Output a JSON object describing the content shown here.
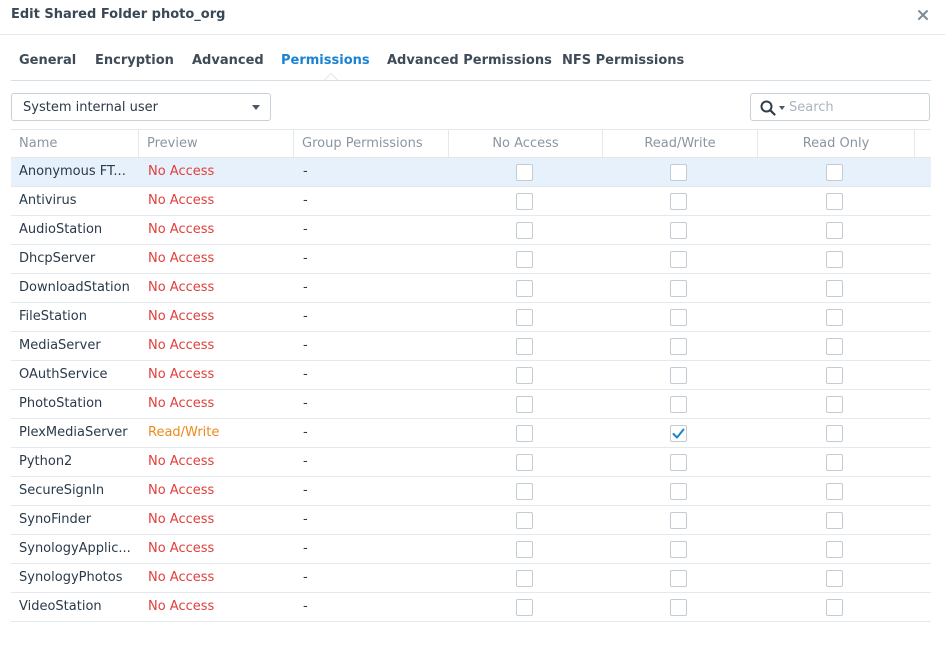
{
  "window": {
    "title": "Edit Shared Folder photo_org"
  },
  "tabs": [
    {
      "label": "General",
      "active": false
    },
    {
      "label": "Encryption",
      "active": false
    },
    {
      "label": "Advanced",
      "active": false
    },
    {
      "label": "Permissions",
      "active": true
    },
    {
      "label": "Advanced Permissions",
      "active": false
    },
    {
      "label": "NFS Permissions",
      "active": false
    }
  ],
  "user_type_select": {
    "value": "System internal user"
  },
  "search": {
    "placeholder": "Search",
    "value": ""
  },
  "columns": {
    "name": "Name",
    "preview": "Preview",
    "group_permissions": "Group Permissions",
    "no_access": "No Access",
    "read_write": "Read/Write",
    "read_only": "Read Only"
  },
  "colors": {
    "accent": "#1a83d1",
    "no_access": "#e0403b",
    "read_write": "#ee8a1c",
    "selected_row": "#e6f1fb"
  },
  "rows": [
    {
      "name": "Anonymous FT...",
      "preview": "No Access",
      "group": "-",
      "no_access": false,
      "read_write": false,
      "read_only": false,
      "selected": true
    },
    {
      "name": "Antivirus",
      "preview": "No Access",
      "group": "-",
      "no_access": false,
      "read_write": false,
      "read_only": false
    },
    {
      "name": "AudioStation",
      "preview": "No Access",
      "group": "-",
      "no_access": false,
      "read_write": false,
      "read_only": false
    },
    {
      "name": "DhcpServer",
      "preview": "No Access",
      "group": "-",
      "no_access": false,
      "read_write": false,
      "read_only": false
    },
    {
      "name": "DownloadStation",
      "preview": "No Access",
      "group": "-",
      "no_access": false,
      "read_write": false,
      "read_only": false
    },
    {
      "name": "FileStation",
      "preview": "No Access",
      "group": "-",
      "no_access": false,
      "read_write": false,
      "read_only": false
    },
    {
      "name": "MediaServer",
      "preview": "No Access",
      "group": "-",
      "no_access": false,
      "read_write": false,
      "read_only": false
    },
    {
      "name": "OAuthService",
      "preview": "No Access",
      "group": "-",
      "no_access": false,
      "read_write": false,
      "read_only": false
    },
    {
      "name": "PhotoStation",
      "preview": "No Access",
      "group": "-",
      "no_access": false,
      "read_write": false,
      "read_only": false
    },
    {
      "name": "PlexMediaServer",
      "preview": "Read/Write",
      "group": "-",
      "no_access": false,
      "read_write": true,
      "read_only": false
    },
    {
      "name": "Python2",
      "preview": "No Access",
      "group": "-",
      "no_access": false,
      "read_write": false,
      "read_only": false
    },
    {
      "name": "SecureSignIn",
      "preview": "No Access",
      "group": "-",
      "no_access": false,
      "read_write": false,
      "read_only": false
    },
    {
      "name": "SynoFinder",
      "preview": "No Access",
      "group": "-",
      "no_access": false,
      "read_write": false,
      "read_only": false
    },
    {
      "name": "SynologyApplic...",
      "preview": "No Access",
      "group": "-",
      "no_access": false,
      "read_write": false,
      "read_only": false
    },
    {
      "name": "SynologyPhotos",
      "preview": "No Access",
      "group": "-",
      "no_access": false,
      "read_write": false,
      "read_only": false
    },
    {
      "name": "VideoStation",
      "preview": "No Access",
      "group": "-",
      "no_access": false,
      "read_write": false,
      "read_only": false
    }
  ]
}
